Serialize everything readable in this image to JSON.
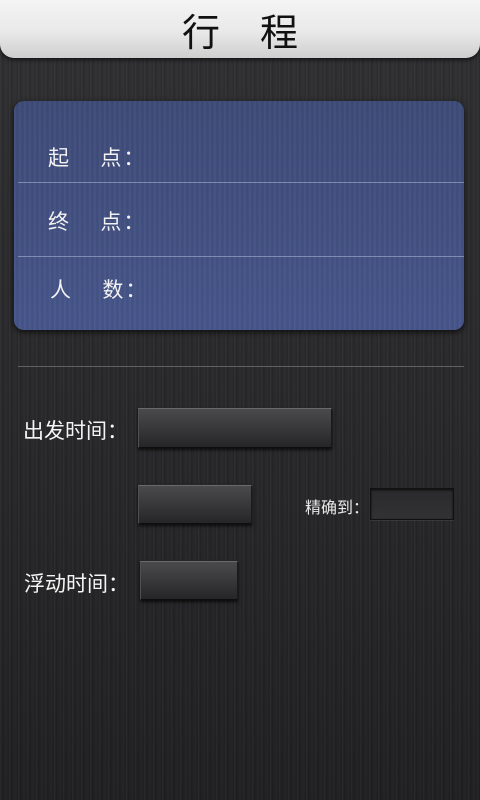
{
  "header": {
    "title": "行 程"
  },
  "trip_panel": {
    "start_label": "起  点：",
    "start_value": "",
    "end_label": "终  点：",
    "end_value": "",
    "count_label": "人  数：",
    "count_value": ""
  },
  "schedule": {
    "depart_label": "出发时间：",
    "depart_date_value": "",
    "depart_time_value": "",
    "precision_label": "精确到：",
    "precision_value": "",
    "float_label": "浮动时间：",
    "float_value": ""
  },
  "colors": {
    "panel_blue": "#445283",
    "background": "#2b2b2d",
    "title_bar": "#ececec"
  }
}
